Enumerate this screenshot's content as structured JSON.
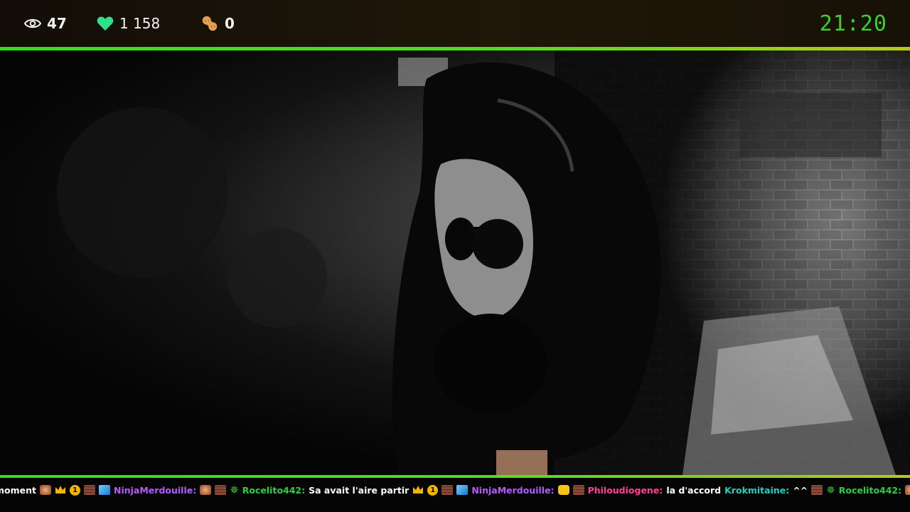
{
  "stats": {
    "viewers": "47",
    "followers": "1 158",
    "peanuts": "0"
  },
  "clock": "21:20",
  "colors": {
    "accent_green": "#3bd12a",
    "heart": "#2ee08a",
    "peanut": "#e3a04f",
    "username_purple": "#b65cff",
    "username_green": "#2ed13c",
    "username_pink": "#ff3f9a",
    "username_teal": "#23d0c0"
  },
  "ticker": [
    {
      "type": "text",
      "text": "moment"
    },
    {
      "type": "badge",
      "icon": "brick-emote-icon"
    },
    {
      "type": "badge",
      "icon": "crown-icon"
    },
    {
      "type": "badge",
      "icon": "one-badge-icon",
      "text": "1"
    },
    {
      "type": "badge",
      "icon": "brick-badge-icon"
    },
    {
      "type": "badge",
      "icon": "cube-badge-icon"
    },
    {
      "type": "user",
      "text": "NinjaMerdouille:",
      "color": "#b65cff"
    },
    {
      "type": "badge",
      "icon": "face-emote-icon"
    },
    {
      "type": "badge",
      "icon": "brick-badge-icon"
    },
    {
      "type": "badge",
      "icon": "star-badge-icon"
    },
    {
      "type": "user",
      "text": "Rocelito442:",
      "color": "#2ed13c"
    },
    {
      "type": "text",
      "text": "Sa avait l'aire partir"
    },
    {
      "type": "badge",
      "icon": "crown-icon"
    },
    {
      "type": "badge",
      "icon": "one-badge-icon",
      "text": "1"
    },
    {
      "type": "badge",
      "icon": "brick-badge-icon"
    },
    {
      "type": "badge",
      "icon": "cube-badge-icon"
    },
    {
      "type": "user",
      "text": "NinjaMerdouille:",
      "color": "#b65cff"
    },
    {
      "type": "badge",
      "icon": "cat-emote-icon"
    },
    {
      "type": "badge",
      "icon": "brick-badge-icon"
    },
    {
      "type": "user",
      "text": "Philoudiogene:",
      "color": "#ff3f9a"
    },
    {
      "type": "text",
      "text": "la d'accord"
    },
    {
      "type": "user",
      "text": "Krokmitaine:",
      "color": "#23d0c0"
    },
    {
      "type": "text",
      "text": "^^"
    },
    {
      "type": "badge",
      "icon": "brick-badge-icon"
    },
    {
      "type": "badge",
      "icon": "star-badge-icon"
    },
    {
      "type": "user",
      "text": "Rocelito442:",
      "color": "#2ed13c"
    },
    {
      "type": "badge",
      "icon": "brick-emote-icon"
    }
  ]
}
